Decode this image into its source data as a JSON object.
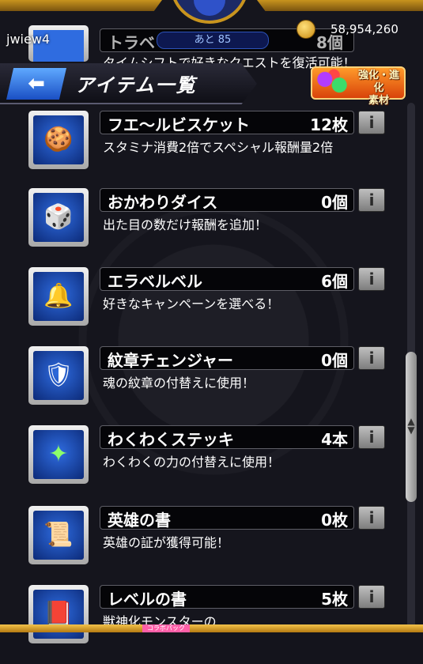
{
  "status": {
    "username": "jwiew4",
    "stamina_text": "あと 85",
    "coins": "58,954,260"
  },
  "header": {
    "back_arrow": "⬅",
    "title": "アイテム一覧",
    "evolve_badge_line1": "強化・進化",
    "evolve_badge_line2": "素材"
  },
  "peek_item": {
    "name": "トラベ",
    "count": "8個",
    "description": "タイムシフトで好きなクエストを復活可能！"
  },
  "items": [
    {
      "name": "フエ〜ルビスケット",
      "count": "12枚",
      "description": "スタミナ消費2倍でスペシャル報酬量2倍",
      "icon": "biscuit-icon",
      "glyph": "🍪"
    },
    {
      "name": "おかわりダイス",
      "count": "0個",
      "description": "出た目の数だけ報酬を追加！",
      "icon": "dice-icon",
      "glyph": "🎲"
    },
    {
      "name": "エラベルベル",
      "count": "6個",
      "description": "好きなキャンペーンを選べる！",
      "icon": "bell-icon",
      "glyph": "🔔"
    },
    {
      "name": "紋章チェンジャー",
      "count": "0個",
      "description": "魂の紋章の付替えに使用！",
      "icon": "emblem-changer-icon",
      "glyph": "🛡"
    },
    {
      "name": "わくわくステッキ",
      "count": "4本",
      "description": "わくわくの力の付替えに使用！",
      "icon": "wand-icon",
      "glyph": "✦"
    },
    {
      "name": "英雄の書",
      "count": "0枚",
      "description": "英雄の証が獲得可能！",
      "icon": "hero-scroll-icon",
      "glyph": "📜"
    },
    {
      "name": "レベルの書",
      "count": "5枚",
      "description": "獣神化モンスターの",
      "icon": "level-book-icon",
      "glyph": "📕"
    }
  ],
  "info_glyph": "i",
  "bottom_tab_label": "コラボパック",
  "colors": {
    "accent_gold": "#c8941e",
    "back_button_blue": "#1a4fc4",
    "badge_orange": "#d9430a"
  }
}
